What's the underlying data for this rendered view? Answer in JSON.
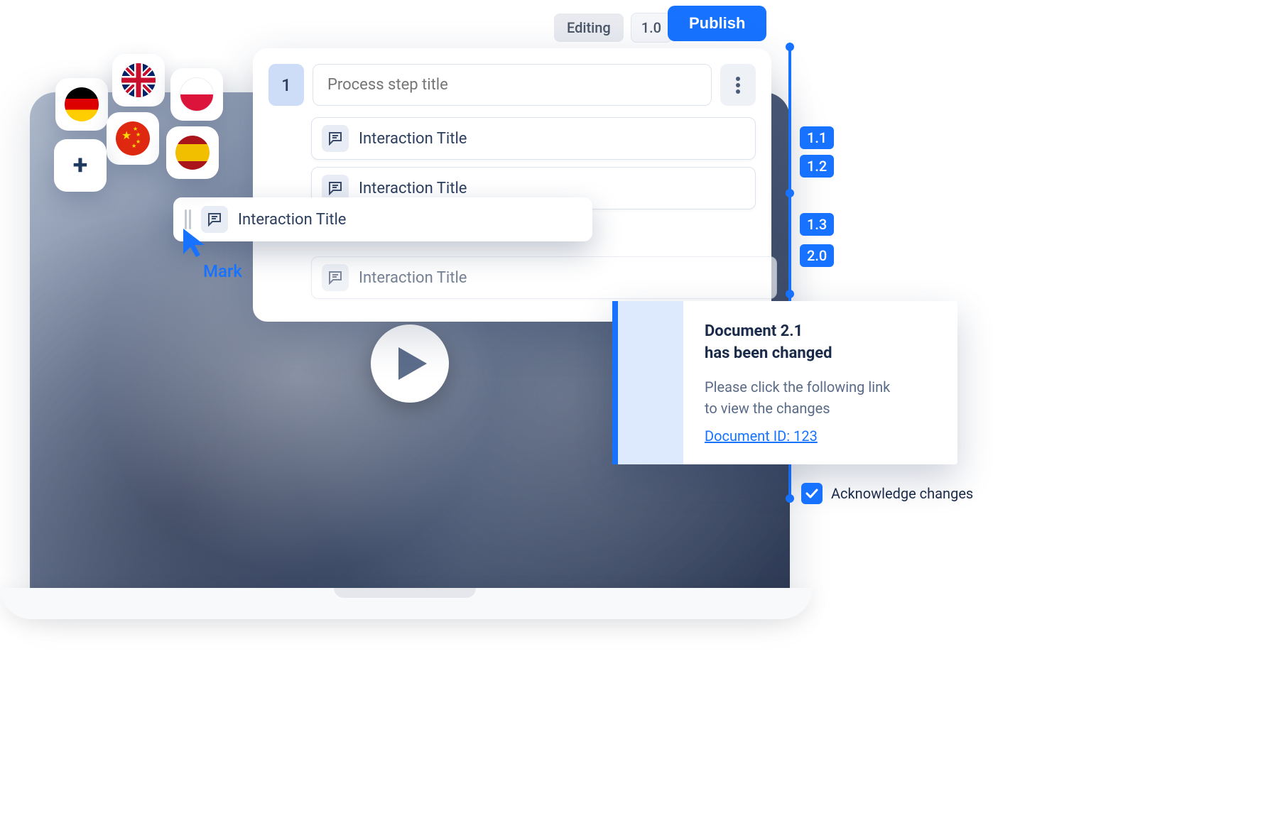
{
  "topbar": {
    "status": "Editing",
    "version": "1.0",
    "publish": "Publish"
  },
  "editor": {
    "step_number": "1",
    "step_title_placeholder": "Process step title",
    "interactions": [
      {
        "title": "Interaction Title"
      },
      {
        "title": "Interaction Title"
      },
      {
        "title": "Interaction Title"
      }
    ],
    "dragged_interaction_title": "Interaction Title"
  },
  "cursor": {
    "user": "Mark"
  },
  "flags": {
    "de": "German flag",
    "uk": "UK flag",
    "pl": "Polish flag",
    "cn": "Chinese flag",
    "es": "Spanish flag",
    "add_label": "+"
  },
  "timeline": {
    "versions": [
      "1.1",
      "1.2",
      "1.3",
      "2.0"
    ]
  },
  "notification": {
    "title_line1": "Document 2.1",
    "title_line2": "has been changed",
    "body_line1": "Please click the following link",
    "body_line2": "to view the changes",
    "link_text": "Document ID: 123"
  },
  "acknowledge": {
    "label": "Acknowledge changes",
    "checked": true
  }
}
